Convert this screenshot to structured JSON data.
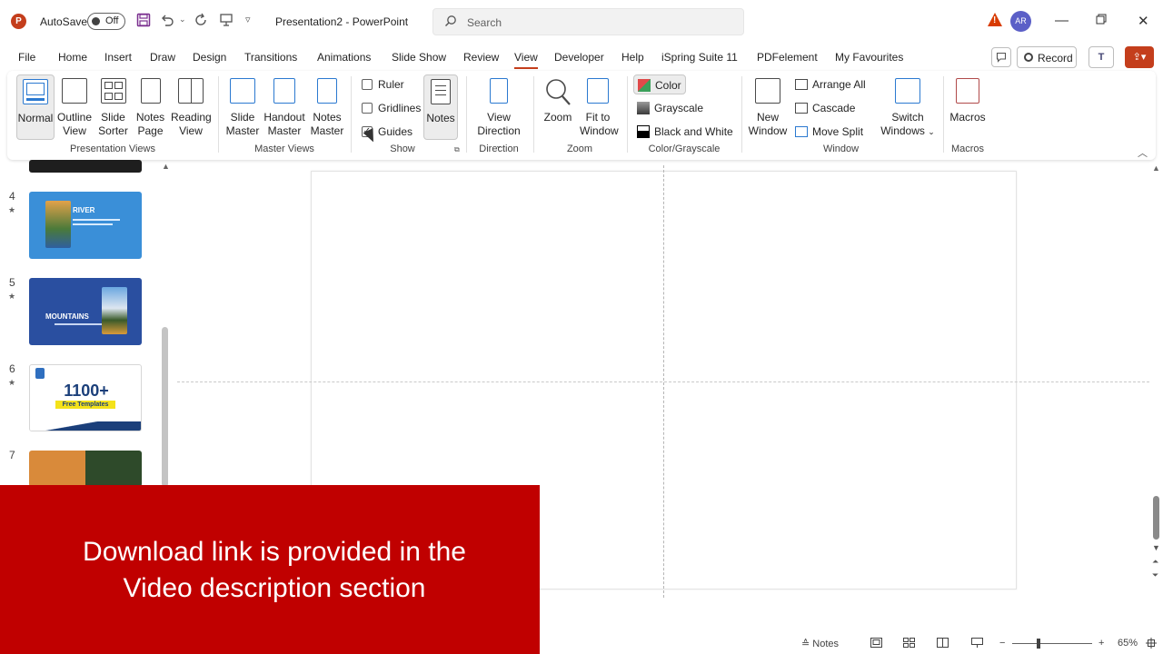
{
  "titlebar": {
    "app_logo": "P",
    "autosave_label": "AutoSave",
    "autosave_state": "Off",
    "document_title": "Presentation2 - PowerPoint",
    "search_placeholder": "Search",
    "avatar_initials": "AR",
    "icons": [
      "save-icon",
      "undo-icon",
      "redo-icon",
      "present-icon",
      "customize-icon",
      "warning-icon",
      "minimize-icon",
      "restore-icon",
      "close-icon"
    ]
  },
  "tabs": [
    {
      "label": "File"
    },
    {
      "label": "Home"
    },
    {
      "label": "Insert"
    },
    {
      "label": "Draw"
    },
    {
      "label": "Design"
    },
    {
      "label": "Transitions"
    },
    {
      "label": "Animations"
    },
    {
      "label": "Slide Show"
    },
    {
      "label": "Review"
    },
    {
      "label": "View",
      "active": true
    },
    {
      "label": "Developer"
    },
    {
      "label": "Help"
    },
    {
      "label": "iSpring Suite 11"
    },
    {
      "label": "PDFelement"
    },
    {
      "label": "My Favourites"
    }
  ],
  "record_label": "Record",
  "ribbon": {
    "presentation_views": {
      "label": "Presentation Views",
      "normal": "Normal",
      "outline": [
        "Outline",
        "View"
      ],
      "slide_sorter": [
        "Slide",
        "Sorter"
      ],
      "notes_page": [
        "Notes",
        "Page"
      ],
      "reading": [
        "Reading",
        "View"
      ]
    },
    "master_views": {
      "label": "Master Views",
      "slide_master": [
        "Slide",
        "Master"
      ],
      "handout_master": [
        "Handout",
        "Master"
      ],
      "notes_master": [
        "Notes",
        "Master"
      ]
    },
    "show": {
      "label": "Show",
      "ruler": "Ruler",
      "gridlines": "Gridlines",
      "guides": "Guides",
      "guides_checked": true,
      "notes": "Notes"
    },
    "direction": {
      "label": "Direction",
      "view_direction": [
        "View",
        "Direction"
      ]
    },
    "zoom": {
      "label": "Zoom",
      "zoom": "Zoom",
      "fit": [
        "Fit to",
        "Window"
      ]
    },
    "color_grayscale": {
      "label": "Color/Grayscale",
      "color": "Color",
      "grayscale": "Grayscale",
      "bw": "Black and White"
    },
    "window": {
      "label": "Window",
      "new_window": [
        "New",
        "Window"
      ],
      "arrange_all": "Arrange All",
      "cascade": "Cascade",
      "move_split": "Move Split",
      "switch": [
        "Switch",
        "Windows"
      ]
    },
    "macros": {
      "label": "Macros",
      "macros": "Macros"
    }
  },
  "slides": [
    {
      "number": "4",
      "title": "RIVER"
    },
    {
      "number": "5",
      "title": "MOUNTAINS"
    },
    {
      "number": "6",
      "title": "1100+",
      "subtitle": "Free Templates"
    },
    {
      "number": "7"
    }
  ],
  "banner": {
    "line1": "Download link is provided in the",
    "line2": "Video description section"
  },
  "statusbar": {
    "notes_label": "Notes",
    "zoom_level": "65%"
  },
  "colors": {
    "accent": "#c43e1c",
    "banner": "#c00000",
    "river_slide": "#3a8fd8",
    "mountains_slide": "#2a4fa0"
  }
}
